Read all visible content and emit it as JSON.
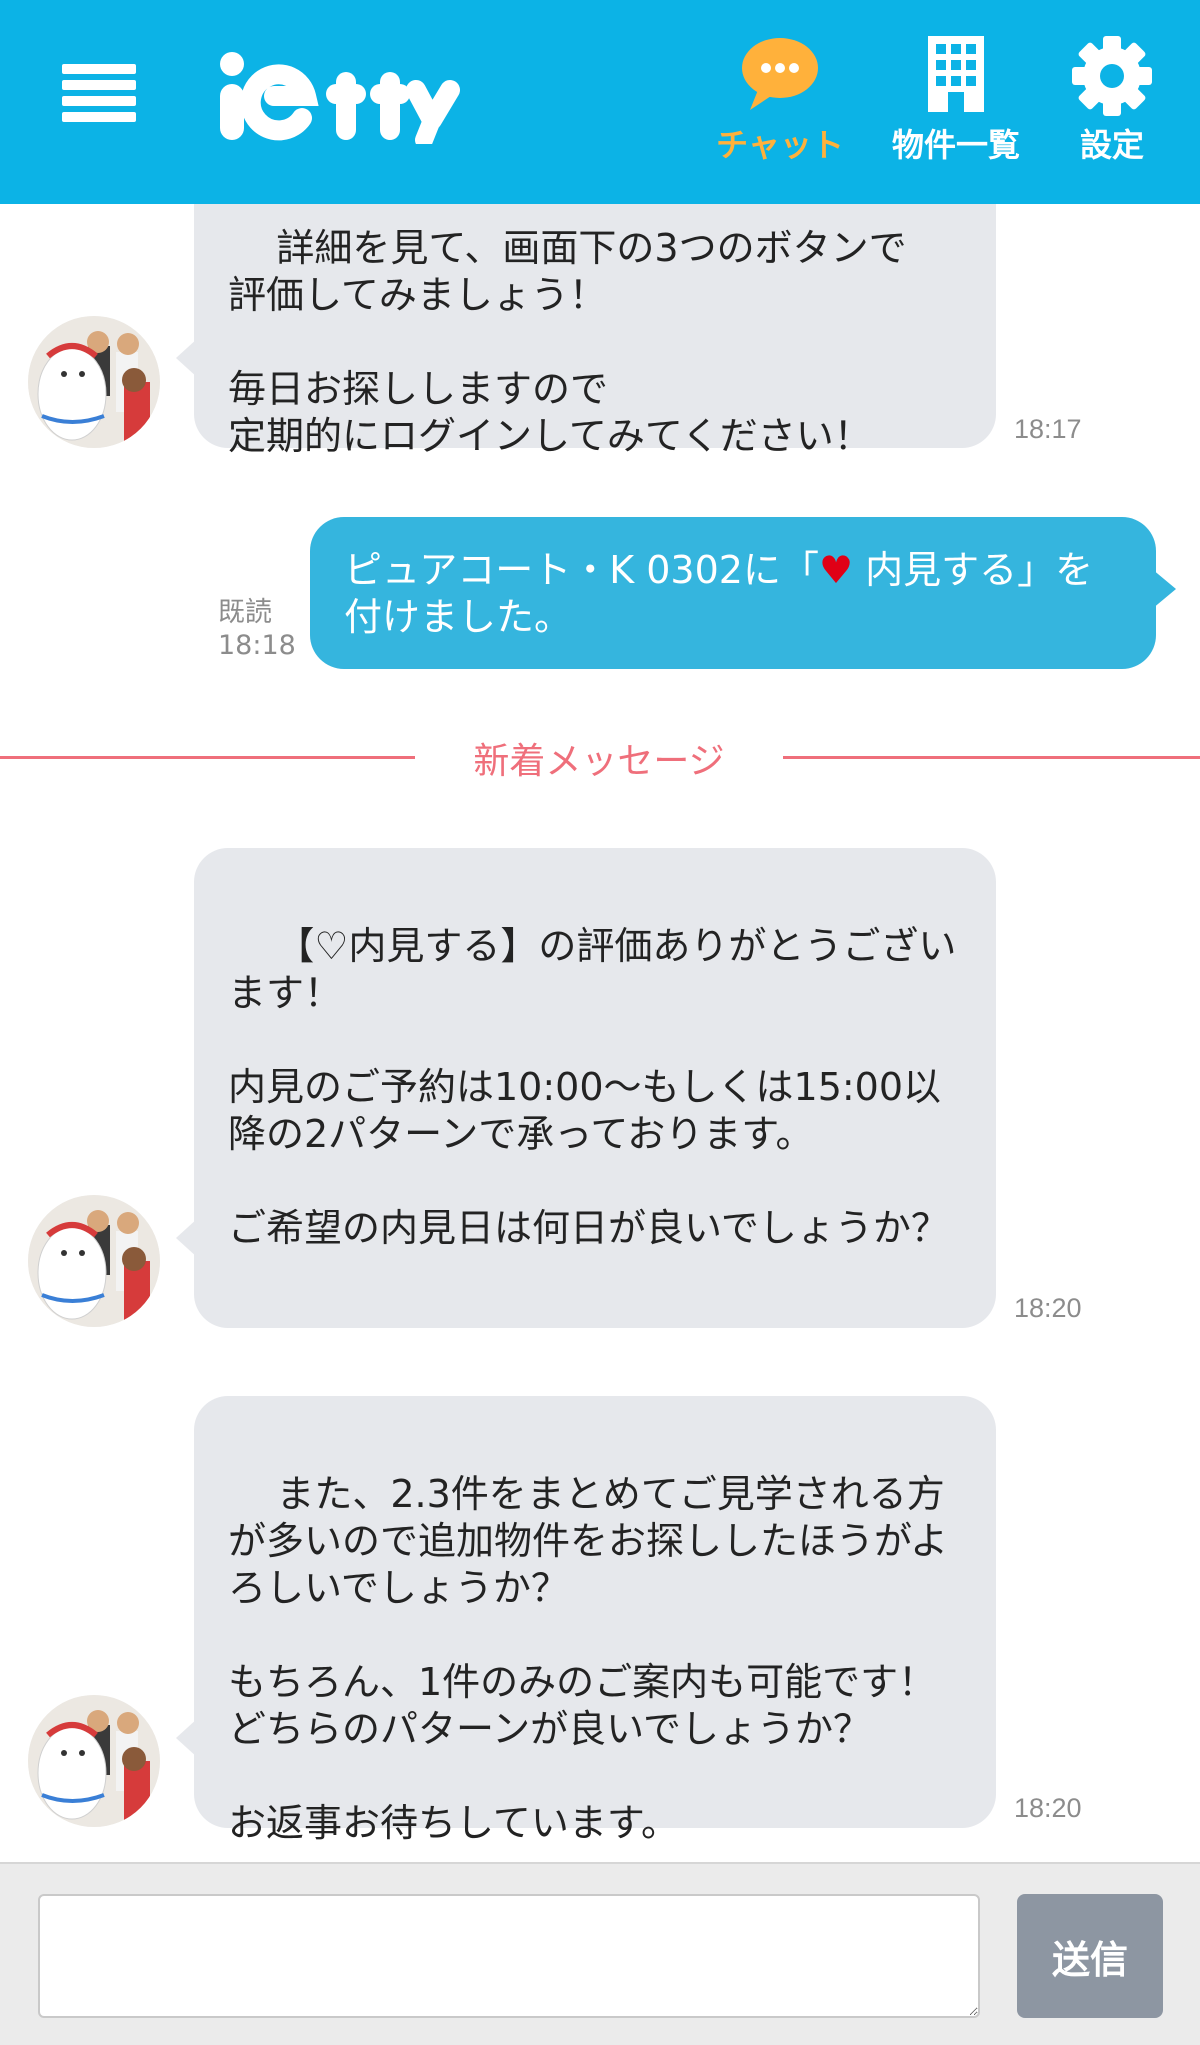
{
  "header": {
    "logo_text": "ietty",
    "nav": [
      {
        "label": "チャット",
        "icon": "chat-bubble-icon",
        "active": true
      },
      {
        "label": "物件一覧",
        "icon": "building-icon",
        "active": false
      },
      {
        "label": "設定",
        "icon": "gear-icon",
        "active": false
      }
    ],
    "colors": {
      "header_bg": "#0cb3e6",
      "active_nav": "#ffb13b"
    }
  },
  "messages": {
    "m1": {
      "text": "詳細を見て、画面下の3つのボタンで\n評価してみましょう！\n\n毎日お探ししますので\n定期的にログインしてみてください！",
      "time": "18:17"
    },
    "m2": {
      "text_before": "ピュアコート・K 0302に「",
      "heart": "♥",
      "text_after": " 内見する」を\n付けました。",
      "read_label": "既読",
      "time": "18:18"
    },
    "new_divider": "新着メッセージ",
    "m3": {
      "text": "【♡内見する】の評価ありがとうございます！\n\n内見のご予約は10:00〜もしくは15:00以降の2パターンで承っております。\n\nご希望の内見日は何日が良いでしょうか？",
      "time": "18:20"
    },
    "m4": {
      "text": "また、2.3件をまとめてご見学される方が多いので追加物件をお探ししたほうがよろしいでしょうか？\n\nもちろん、1件のみのご案内も可能です！\nどちらのパターンが良いでしょうか？\n\nお返事お待ちしています。",
      "time": "18:20"
    }
  },
  "composer": {
    "placeholder": "",
    "send_label": "送信"
  }
}
